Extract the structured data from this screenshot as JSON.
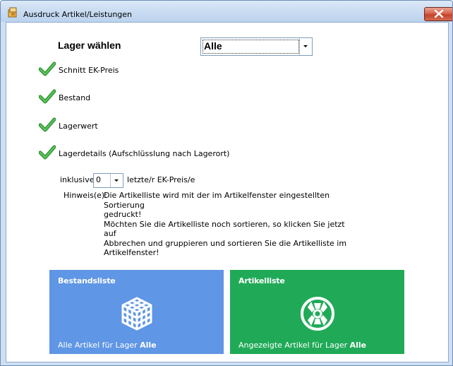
{
  "window": {
    "title": "Ausdruck Artikel/Leistungen",
    "close_label": "✕"
  },
  "lager": {
    "label": "Lager wählen",
    "selected": "Alle"
  },
  "options": [
    {
      "label": "Schnitt EK-Preis",
      "checked": true
    },
    {
      "label": "Bestand",
      "checked": true
    },
    {
      "label": "Lagerwert",
      "checked": true
    },
    {
      "label": "Lagerdetails (Aufschlüsslung nach Lagerort)",
      "checked": true
    }
  ],
  "inklusive": {
    "label": "inklusive",
    "value": "0",
    "suffix": "letzte/r EK-Preis/e"
  },
  "hinweis": {
    "label": "Hinweis(e):",
    "text": "Die Artikelliste wird mit der im Artikelfenster eingestellten Sortierung\ngedruckt!\nMöchten Sie die Artikelliste noch sortieren, so klicken Sie jetzt auf\nAbbrechen und gruppieren und sortieren Sie die Artikelliste im\nArtikelfenster!"
  },
  "tiles": {
    "bestandsliste": {
      "title": "Bestandsliste",
      "sub_prefix": "Alle Artikel für Lager",
      "sub_value": "Alle",
      "color": "#5f96e5",
      "icon": "cube-icon"
    },
    "artikelliste": {
      "title": "Artikelliste",
      "sub_prefix": "Angezeigte Artikel für Lager",
      "sub_value": "Alle",
      "color": "#20aa58",
      "icon": "film-reel-icon"
    }
  },
  "colors": {
    "check": "#3aa43a",
    "close": "#c94a32"
  }
}
